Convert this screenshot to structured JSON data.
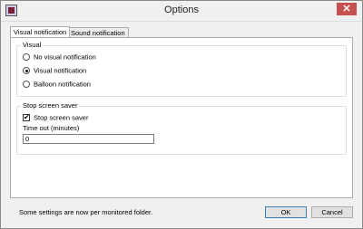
{
  "window": {
    "title": "Options",
    "close_glyph": "✕"
  },
  "tabs": [
    {
      "label": "Visual notification",
      "active": true
    },
    {
      "label": "Sound notification",
      "active": false
    }
  ],
  "visual_group": {
    "title": "Visual",
    "options": [
      {
        "label": "No visual notification",
        "checked": false
      },
      {
        "label": "Visual notification",
        "checked": true
      },
      {
        "label": "Balloon notification",
        "checked": false
      }
    ]
  },
  "screensaver_group": {
    "title": "Stop screen saver",
    "checkbox_label": "Stop screen saver",
    "checkbox_checked": true,
    "checkbox_glyph": "✔",
    "timeout_label": "Time out (minutes)",
    "timeout_value": "0"
  },
  "footer": {
    "note": "Some settings are now per monitored folder.",
    "ok_label": "OK",
    "cancel_label": "Cancel"
  }
}
